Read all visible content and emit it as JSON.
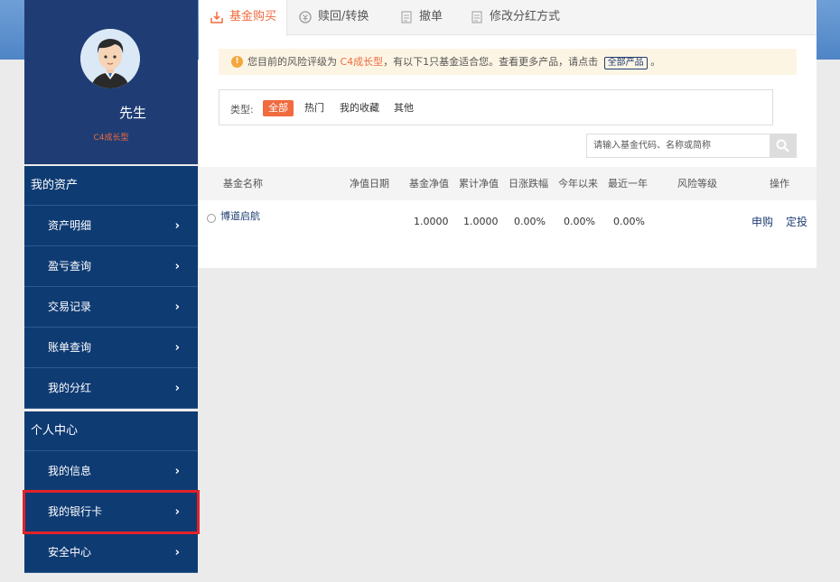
{
  "profile": {
    "name": "先生",
    "risk_level": "C4成长型"
  },
  "nav": {
    "sections": [
      {
        "title": "我的资产",
        "items": [
          "资产明细",
          "盈亏查询",
          "交易记录",
          "账单查询",
          "我的分红"
        ]
      },
      {
        "title": "个人中心",
        "items": [
          "我的信息",
          "我的银行卡",
          "安全中心"
        ]
      }
    ]
  },
  "tabs": [
    {
      "label": "基金购买",
      "icon": "cart-icon",
      "active": true
    },
    {
      "label": "赎回/转换",
      "icon": "redeem-icon",
      "active": false
    },
    {
      "label": "撤单",
      "icon": "document-icon",
      "active": false
    },
    {
      "label": "修改分红方式",
      "icon": "document-icon",
      "active": false
    }
  ],
  "notice": {
    "prefix": "您目前的风险评级为",
    "risk": "C4成长型",
    "suffix": "，有以下1只基金适合您。查看更多产品，请点击",
    "button": "全部产品",
    "end": "。"
  },
  "filter": {
    "label": "类型:",
    "options": [
      "全部",
      "热门",
      "我的收藏",
      "其他"
    ],
    "selected": "全部"
  },
  "search": {
    "placeholder": "请输入基金代码、名称或简称"
  },
  "table": {
    "headers": [
      "基金名称",
      "净值日期",
      "基金净值",
      "累计净值",
      "日涨跌幅",
      "今年以来",
      "最近一年",
      "风险等级",
      "操作"
    ],
    "rows": [
      {
        "name": "博道启航",
        "date": "",
        "nav": "1.0000",
        "acc_nav": "1.0000",
        "daily": "0.00%",
        "ytd": "0.00%",
        "year": "0.00%",
        "risk": "",
        "actions": [
          "申购",
          "定投"
        ]
      }
    ]
  },
  "colors": {
    "sidebar": "#0f3b73",
    "accent": "#f06b3e",
    "highlight": "#e2232a"
  }
}
